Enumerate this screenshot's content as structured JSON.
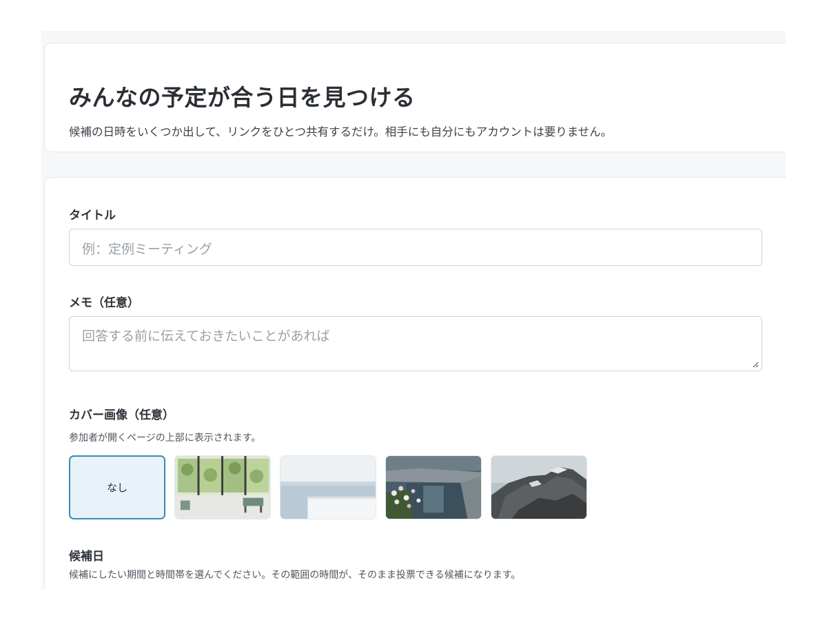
{
  "hero": {
    "title": "みんなの予定が合う日を見つける",
    "subtitle": "候補の日時をいくつか出して、リンクをひとつ共有するだけ。相手にも自分にもアカウントは要りません。"
  },
  "form": {
    "title": {
      "label": "タイトル",
      "placeholder": "例：定例ミーティング",
      "value": ""
    },
    "memo": {
      "label": "メモ（任意）",
      "placeholder": "回答する前に伝えておきたいことがあれば",
      "value": ""
    },
    "cover": {
      "label": "カバー画像（任意）",
      "hint": "参加者が開くページの上部に表示されます。",
      "options": [
        {
          "label": "なし",
          "selected": true
        },
        {
          "icon": "cover-glass-garden",
          "selected": false
        },
        {
          "icon": "cover-sea-horizon",
          "selected": false
        },
        {
          "icon": "cover-pond-flowers",
          "selected": false
        },
        {
          "icon": "cover-rocky-mountain",
          "selected": false
        }
      ]
    },
    "dates": {
      "label": "候補日",
      "hint": "候補にしたい期間と時間帯を選んでください。その範囲の時間が、そのまま投票できる候補になります。"
    }
  },
  "colors": {
    "accent": "#3a8bb3",
    "selected_bg": "#e8f2f8",
    "page_bg": "#f6f7f9"
  }
}
